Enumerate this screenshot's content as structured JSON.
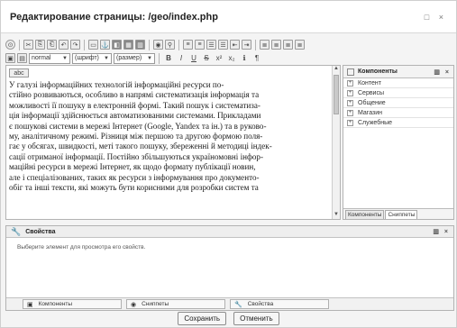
{
  "window": {
    "title": "Редактирование страницы: /geo/index.php",
    "controls": "□ ×"
  },
  "toolbar": {
    "row1_icons": [
      "⊙",
      "✂",
      "⎘",
      "⎗",
      "↶",
      "↷",
      "▭",
      "⚓",
      "◧",
      "▦",
      "▥",
      "◉",
      "⚲",
      "≡",
      "≡",
      "☰",
      "☰",
      "⇤",
      "⇥",
      "≣",
      "≣",
      "≣",
      "≣"
    ],
    "row2_icons": [
      "▣",
      "▤"
    ],
    "style_select": "normal",
    "font_select": "(шрифт)",
    "size_select": "(размер)",
    "format_icons": [
      "B",
      "I",
      "U",
      "S",
      "x²",
      "x₂",
      "ℹ",
      "¶"
    ]
  },
  "editor": {
    "tag_label": "abc",
    "lines": [
      "У галузі інформаційних технологій інформаційні ресурси по-",
      "стійно розвиваються, особливо в напрямі систематизація інформація та",
      "можливості її пошуку в електронній формі. Такий пошук і систематиза-",
      "ція інформації здійснюється автоматизованими системами. Прикладами",
      "є пошукові системи в мережі Інтернет (Google, Yandex та ін.) та в руково-",
      "му, аналітичному режимі. Різниця між першою та другою формою поля-",
      "гає у обсягах, швидкості, меті такого пошуку, збереженні й методиці індек-",
      "сації отриманої інформації. Поєтійно збільшуються україномовні інфор-",
      "маційні ресурси в мережі Інтернет, як щодо формату публікації новин,",
      "але і спеціалізованих, таких як ресурси з інформування про документо-",
      "обіг та інші тексти, які можуть бути корисними для розробки систем та"
    ]
  },
  "components": {
    "title": "Компоненты",
    "header_buttons": "▥ ×",
    "items": [
      "Контент",
      "Сервисы",
      "Общение",
      "Магазин",
      "Служебные"
    ],
    "tabs": [
      "Компоненты",
      "Сниппеты"
    ]
  },
  "properties": {
    "title": "Свойства",
    "header_buttons": "▥ ×",
    "hint": "Выберите элемент для просмотра его свойств.",
    "tabs": [
      "Компоненты",
      "Сниппеты",
      "Свойства"
    ]
  },
  "buttons": {
    "save": "Сохранить",
    "cancel": "Отменить"
  }
}
